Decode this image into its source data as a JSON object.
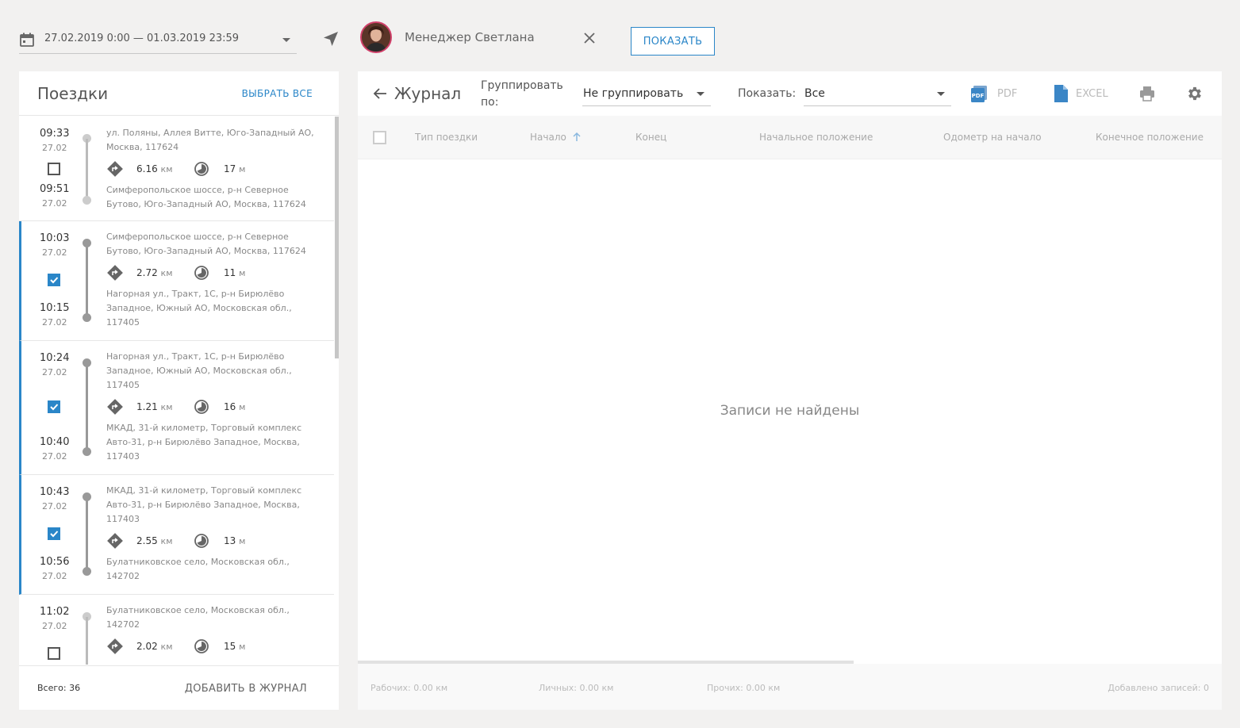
{
  "topbar": {
    "date_range": "27.02.2019 0:00 — 01.03.2019 23:59",
    "user_name": "Менеджер Светлана",
    "show_button": "ПОКАЗАТЬ"
  },
  "trips_panel": {
    "title": "Поездки",
    "select_all": "ВЫБРАТЬ ВСЕ",
    "total": "Всего: 36",
    "add_to_journal": "ДОБАВИТЬ В ЖУРНАЛ",
    "trips": [
      {
        "start_time": "09:33",
        "start_date": "27.02",
        "end_time": "09:51",
        "end_date": "27.02",
        "selected": false,
        "start_address": "ул. Поляны, Аллея Витте, Юго-Западный АО, Москва, 117624",
        "end_address": "Симферопольское шоссе, р-н Северное Бутово, Юго-Западный АО, Москва, 117624",
        "distance": "6.16",
        "distance_unit": "км",
        "duration": "17",
        "duration_unit": "м"
      },
      {
        "start_time": "10:03",
        "start_date": "27.02",
        "end_time": "10:15",
        "end_date": "27.02",
        "selected": true,
        "start_address": "Симферопольское шоссе, р-н Северное Бутово, Юго-Западный АО, Москва, 117624",
        "end_address": "Нагорная ул., Тракт, 1С, р-н Бирюлёво Западное, Южный АО, Московская обл., 117405",
        "distance": "2.72",
        "distance_unit": "км",
        "duration": "11",
        "duration_unit": "м"
      },
      {
        "start_time": "10:24",
        "start_date": "27.02",
        "end_time": "10:40",
        "end_date": "27.02",
        "selected": true,
        "start_address": "Нагорная ул., Тракт, 1С, р-н Бирюлёво Западное, Южный АО, Московская обл., 117405",
        "end_address": "МКАД, 31-й километр, Торговый комплекс Авто-31, р-н Бирюлёво Западное, Москва, 117403",
        "distance": "1.21",
        "distance_unit": "км",
        "duration": "16",
        "duration_unit": "м"
      },
      {
        "start_time": "10:43",
        "start_date": "27.02",
        "end_time": "10:56",
        "end_date": "27.02",
        "selected": true,
        "start_address": "МКАД, 31-й километр, Торговый комплекс Авто-31, р-н Бирюлёво Западное, Москва, 117403",
        "end_address": "Булатниковское село, Московская обл., 142702",
        "distance": "2.55",
        "distance_unit": "км",
        "duration": "13",
        "duration_unit": "м"
      },
      {
        "start_time": "11:02",
        "start_date": "27.02",
        "end_time": "",
        "end_date": "",
        "selected": false,
        "start_address": "Булатниковское село, Московская обл., 142702",
        "end_address": "",
        "distance": "2.02",
        "distance_unit": "км",
        "duration": "15",
        "duration_unit": "м"
      }
    ]
  },
  "journal_panel": {
    "title": "Журнал",
    "group_label": "Группировать по:",
    "group_value": "Не группировать",
    "show_label": "Показать:",
    "show_value": "Все",
    "pdf_label": "PDF",
    "excel_label": "EXCEL",
    "columns": [
      "Тип поездки",
      "Начало",
      "Конец",
      "Начальное положение",
      "Одометр на начало",
      "Конечное положение"
    ],
    "empty_message": "Записи не найдены",
    "footer": {
      "work": "Рабочих: 0.00 км",
      "personal": "Личных: 0.00 км",
      "other": "Прочих: 0.00 км",
      "added": "Добавлено записей: 0"
    }
  },
  "colors": {
    "accent": "#2a86c8",
    "background": "#f2f1f0",
    "panel": "#ffffff"
  }
}
